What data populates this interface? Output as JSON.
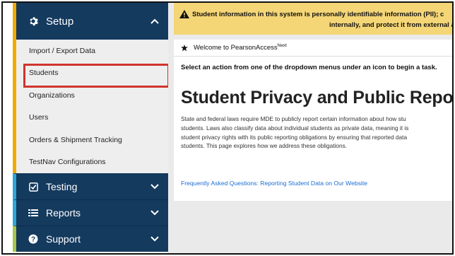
{
  "sidebar": {
    "setup": {
      "label": "Setup",
      "icon": "gear-icon"
    },
    "setup_items": [
      {
        "label": "Import / Export Data"
      },
      {
        "label": "Students",
        "selected": true
      },
      {
        "label": "Organizations"
      },
      {
        "label": "Users"
      },
      {
        "label": "Orders & Shipment Tracking"
      },
      {
        "label": "TestNav Configurations"
      }
    ],
    "testing": {
      "label": "Testing",
      "icon": "checkbox-icon"
    },
    "reports": {
      "label": "Reports",
      "icon": "reports-icon"
    },
    "support": {
      "label": "Support",
      "icon": "help-icon"
    }
  },
  "alert": {
    "line1": "Student information in this system is personally identifiable information (PII); c",
    "line2": "internally, and protect it from external a"
  },
  "welcome": {
    "prefix": "Welcome to PearsonAccess",
    "sup": "Next"
  },
  "instructions": "Select an action from one of the dropdown menus under an icon to begin a task.",
  "heading": "Student Privacy and Public Reports",
  "paragraph_lines": [
    "State and federal laws require MDE to publicly report certain information about how stu",
    "students. Laws also classify data about individual students as private data, meaning it is",
    "student privacy rights with its public reporting obligations by ensuring that reported data",
    "students. This page explores how we address these obligations."
  ],
  "faq_link": "Frequently Asked Questions: Reporting Student Data on Our Website",
  "colors": {
    "nav": "#143a5e",
    "alert": "#f5d676",
    "selected_outline": "#d0342c",
    "link": "#1a6dd6"
  }
}
